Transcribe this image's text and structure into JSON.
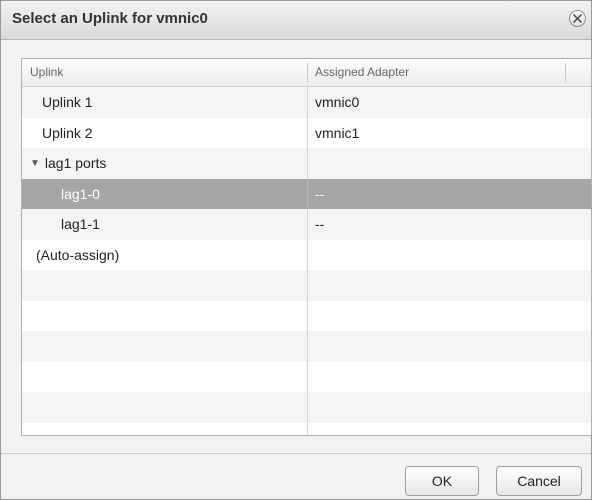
{
  "dialog": {
    "title": "Select an Uplink for vmnic0",
    "close_icon": "close-circle-icon"
  },
  "table": {
    "columns": [
      "Uplink",
      "Assigned Adapter"
    ],
    "rows": [
      {
        "uplink": "Uplink 1",
        "adapter": "vmnic0"
      },
      {
        "uplink": "Uplink 2",
        "adapter": "vmnic1"
      },
      {
        "uplink": "lag1 ports",
        "adapter": "",
        "expanded": true
      },
      {
        "uplink": "lag1-0",
        "adapter": "--",
        "selected": true
      },
      {
        "uplink": "lag1-1",
        "adapter": "--"
      },
      {
        "uplink": "(Auto-assign)",
        "adapter": ""
      }
    ],
    "group_caret": "▼"
  },
  "buttons": {
    "ok": "OK",
    "cancel": "Cancel"
  },
  "colors": {
    "selected_row": "#a6a6a6",
    "alt_row": "#f4f4f4"
  }
}
